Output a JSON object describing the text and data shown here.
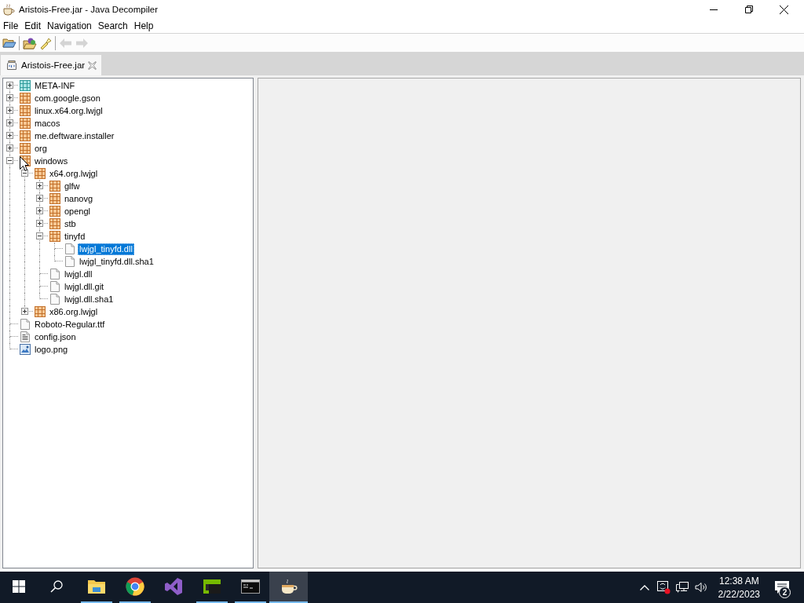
{
  "window": {
    "title": "Aristois-Free.jar - Java Decompiler"
  },
  "menu": [
    "File",
    "Edit",
    "Navigation",
    "Search",
    "Help"
  ],
  "toolbar": [
    {
      "kind": "open",
      "disabled": false
    },
    {
      "kind": "separator"
    },
    {
      "kind": "open-type",
      "disabled": false
    },
    {
      "kind": "search",
      "disabled": false
    },
    {
      "kind": "separator"
    },
    {
      "kind": "back",
      "disabled": true
    },
    {
      "kind": "forward",
      "disabled": true
    }
  ],
  "tabs": [
    {
      "label": "Aristois-Free.jar",
      "selected": true
    }
  ],
  "tree": [
    {
      "label": "META-INF",
      "kind": "folder",
      "expanded": false,
      "selected": false
    },
    {
      "label": "com.google.gson",
      "kind": "package",
      "expanded": false,
      "selected": false
    },
    {
      "label": "linux.x64.org.lwjgl",
      "kind": "package",
      "expanded": false,
      "selected": false
    },
    {
      "label": "macos",
      "kind": "package",
      "expanded": false,
      "selected": false
    },
    {
      "label": "me.deftware.installer",
      "kind": "package",
      "expanded": false,
      "selected": false
    },
    {
      "label": "org",
      "kind": "package",
      "expanded": false,
      "selected": false
    },
    {
      "label": "windows",
      "kind": "package",
      "expanded": true,
      "selected": false,
      "children": [
        {
          "label": "x64.org.lwjgl",
          "kind": "package",
          "expanded": true,
          "selected": false,
          "children": [
            {
              "label": "glfw",
              "kind": "package",
              "expanded": false,
              "selected": false
            },
            {
              "label": "nanovg",
              "kind": "package",
              "expanded": false,
              "selected": false
            },
            {
              "label": "opengl",
              "kind": "package",
              "expanded": false,
              "selected": false
            },
            {
              "label": "stb",
              "kind": "package",
              "expanded": false,
              "selected": false
            },
            {
              "label": "tinyfd",
              "kind": "package",
              "expanded": true,
              "selected": false,
              "children": [
                {
                  "label": "lwjgl_tinyfd.dll",
                  "kind": "file",
                  "selected": true
                },
                {
                  "label": "lwjgl_tinyfd.dll.sha1",
                  "kind": "file",
                  "selected": false
                }
              ]
            },
            {
              "label": "lwjgl.dll",
              "kind": "file",
              "selected": false
            },
            {
              "label": "lwjgl.dll.git",
              "kind": "file",
              "selected": false
            },
            {
              "label": "lwjgl.dll.sha1",
              "kind": "file",
              "selected": false
            }
          ]
        },
        {
          "label": "x86.org.lwjgl",
          "kind": "package",
          "expanded": false,
          "selected": false
        }
      ]
    },
    {
      "label": "Roboto-Regular.ttf",
      "kind": "file",
      "selected": false
    },
    {
      "label": "config.json",
      "kind": "text",
      "selected": false
    },
    {
      "label": "logo.png",
      "kind": "image",
      "selected": false
    }
  ],
  "taskbar": {
    "apps": [
      {
        "kind": "folder",
        "running": true,
        "selected": false
      },
      {
        "kind": "browser",
        "running": true,
        "selected": false
      },
      {
        "kind": "ide",
        "running": false,
        "selected": false
      },
      {
        "kind": "tile",
        "running": true,
        "selected": false
      },
      {
        "kind": "terminal",
        "running": true,
        "selected": false
      },
      {
        "kind": "cup",
        "running": true,
        "selected": true
      }
    ],
    "time": "12:38 AM",
    "date": "2/22/2023",
    "notifications": "2"
  }
}
